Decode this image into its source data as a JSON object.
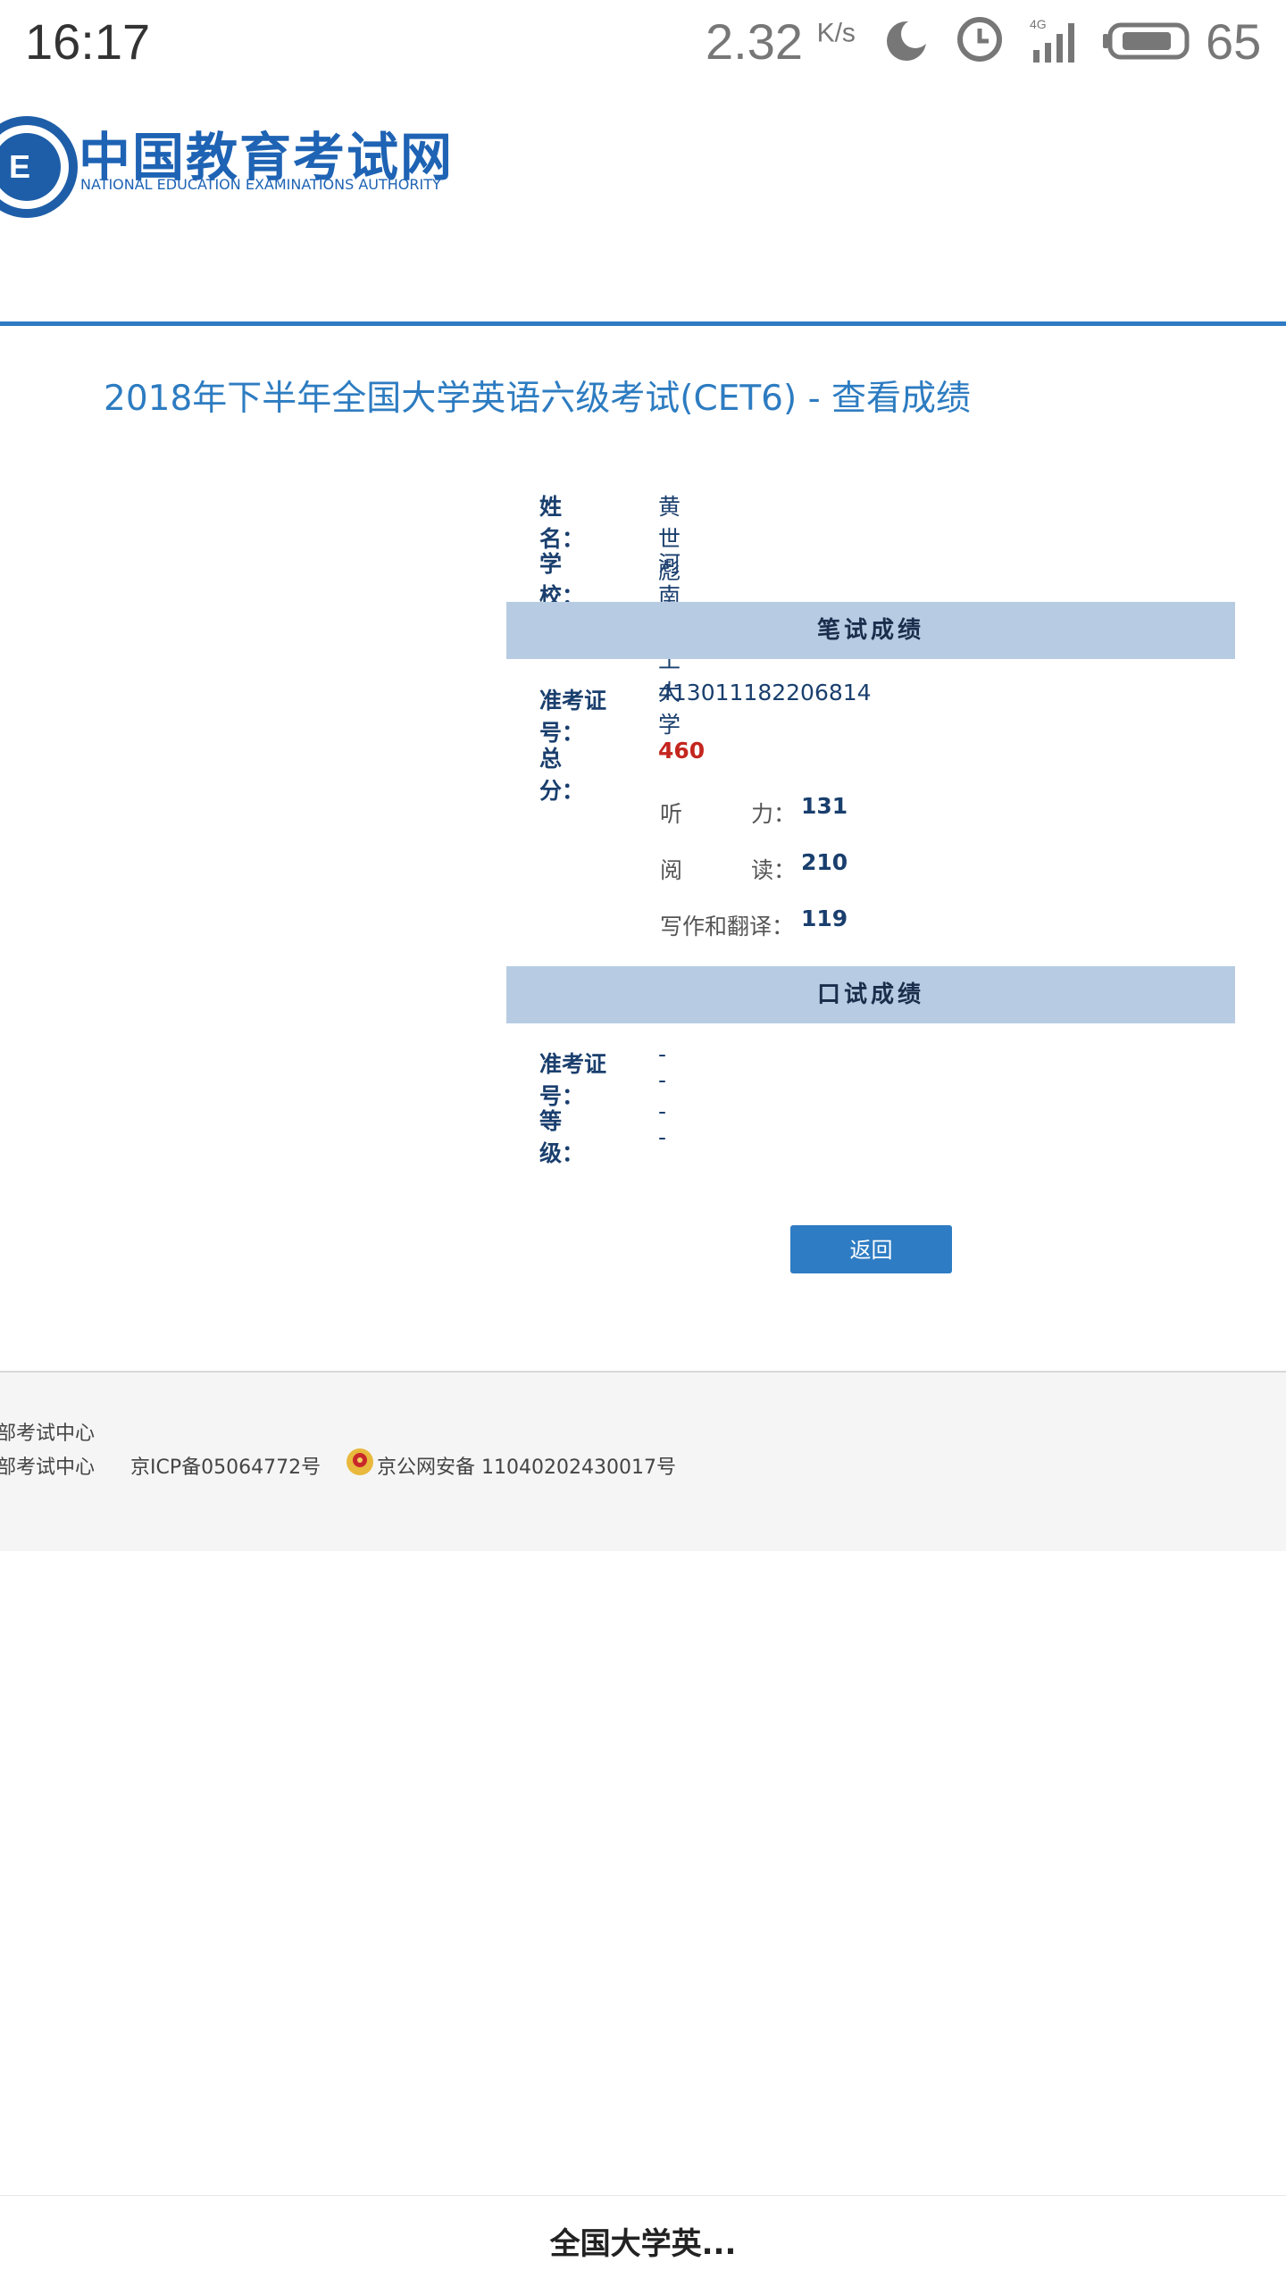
{
  "status_bar": {
    "time": "16:17",
    "speed_value": "2.32",
    "speed_unit": "K/s",
    "network": "4G",
    "battery": "65"
  },
  "header": {
    "logo_cn": "中国教育考试网",
    "logo_en": "NATIONAL EDUCATION EXAMINATIONS AUTHORITY",
    "accent_color": "#2e7bc4"
  },
  "page": {
    "title": "2018年下半年全国大学英语六级考试(CET6) - 查看成绩"
  },
  "info": {
    "name_label_a": "姓",
    "name_label_b": "名：",
    "name_value": "黄世彪",
    "school_label_a": "学",
    "school_label_b": "校：",
    "school_value": "河南理工大学"
  },
  "written": {
    "section_title": "笔试成绩",
    "ticket_label": "准考证号：",
    "ticket_value": "413011182206814",
    "total_label_a": "总",
    "total_label_b": "分：",
    "total_value": "460",
    "listening_label_a": "听",
    "listening_label_b": "力：",
    "listening_value": "131",
    "reading_label_a": "阅",
    "reading_label_b": "读：",
    "reading_value": "210",
    "writing_label": "写作和翻译：",
    "writing_value": "119"
  },
  "oral": {
    "section_title": "口试成绩",
    "ticket_label": "准考证号：",
    "ticket_value": "--",
    "grade_label_a": "等",
    "grade_label_b": "级：",
    "grade_value": "--"
  },
  "actions": {
    "back_label": "返回"
  },
  "footer": {
    "line1": "部考试中心",
    "line2": "部考试中心",
    "icp": "京ICP备05064772号",
    "police": "京公网安备 11040202430017号"
  },
  "bottom_bar": {
    "title": "全国大学英..."
  }
}
